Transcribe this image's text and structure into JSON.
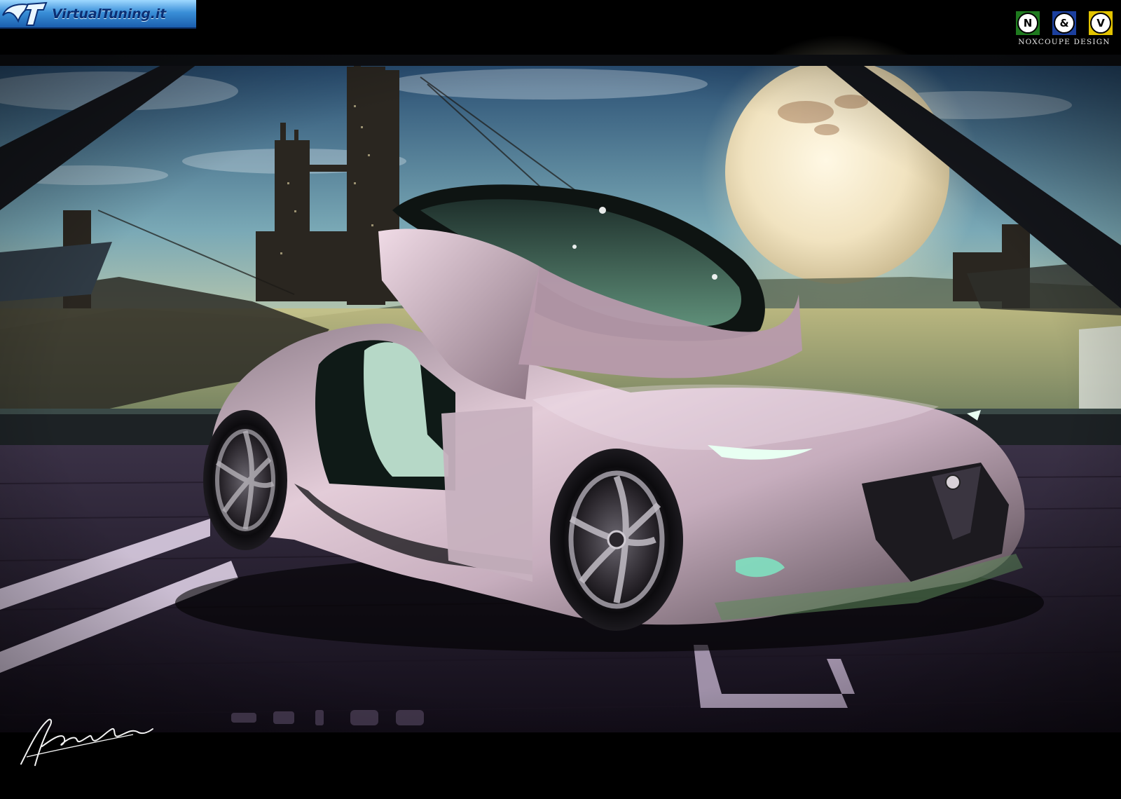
{
  "badge": {
    "site_text": "VirtualTuning.it",
    "background_color": "#2f7fd0",
    "text_color": "#0b2f74"
  },
  "design_logos": {
    "tiles": [
      {
        "letter": "N",
        "color": "#1f7a1f"
      },
      {
        "letter": "&",
        "color": "#1b3f9e"
      },
      {
        "letter": "V",
        "color": "#e3c400"
      }
    ],
    "caption": "NOXCOUPE DESIGN"
  },
  "scene": {
    "subject": "futuristic silver-pink concept sports car with gull-wing doors open",
    "background": "sci-fi harbor with towers, ships and a large pale planet at sunset",
    "floor": "dark purple wooden deck with white painted lines",
    "palette": {
      "sky_top": "#2b4f72",
      "sky_glow": "#f4f0c8",
      "water": "#c9c48a",
      "deck": "#2a2033",
      "car_body": "#cbb3c2",
      "car_glass": "#2f5a4e",
      "frame": "#111318"
    }
  },
  "signature": {
    "style": "handwritten autograph"
  }
}
